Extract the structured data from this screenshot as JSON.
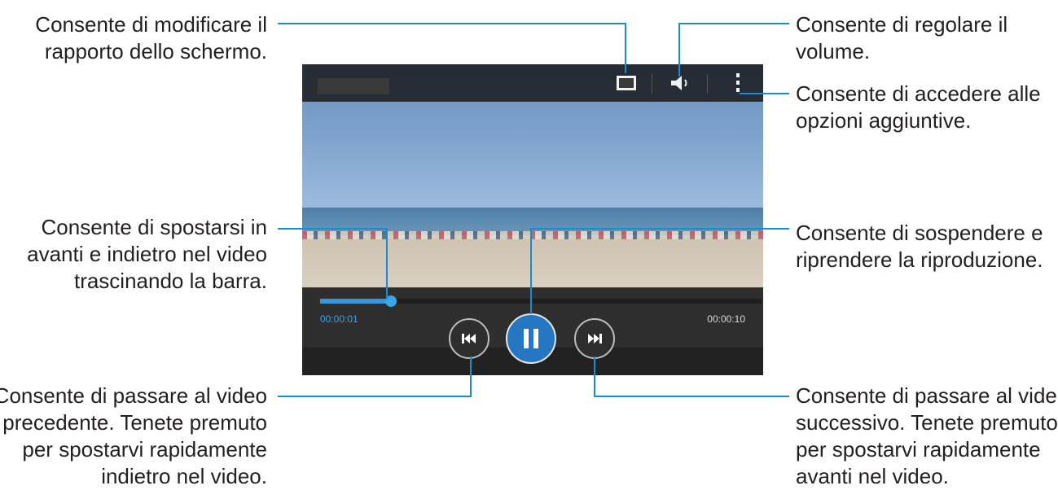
{
  "callouts": {
    "ratio": [
      "Consente di modificare il",
      "rapporto dello schermo."
    ],
    "volume": [
      "Consente di regolare il",
      "volume."
    ],
    "options": [
      "Consente di accedere alle",
      "opzioni aggiuntive."
    ],
    "seek": [
      "Consente di spostarsi in",
      "avanti e indietro nel video",
      "trascinando la barra."
    ],
    "pause": [
      "Consente di sospendere e",
      "riprendere la riproduzione."
    ],
    "previous": [
      "Consente di passare al video",
      "precedente. Tenete premuto",
      "per spostarvi rapidamente",
      "indietro nel video."
    ],
    "next": [
      "Consente di passare al video",
      "successivo. Tenete premuto",
      "per spostarvi rapidamente",
      "avanti nel video."
    ]
  },
  "player": {
    "elapsed": "00:00:01",
    "duration": "00:00:10",
    "progress": 0.16
  },
  "icons": {
    "ratio": "aspect-ratio-icon",
    "volume": "volume-icon",
    "options": "more-options-icon",
    "previous": "skip-previous-icon",
    "pause": "pause-icon",
    "next": "skip-next-icon"
  },
  "colors": {
    "callout_line": "#1c8ad0",
    "accent": "#2577c4",
    "time_elapsed": "#3fa0e6",
    "time_total": "#d8d8d8"
  }
}
